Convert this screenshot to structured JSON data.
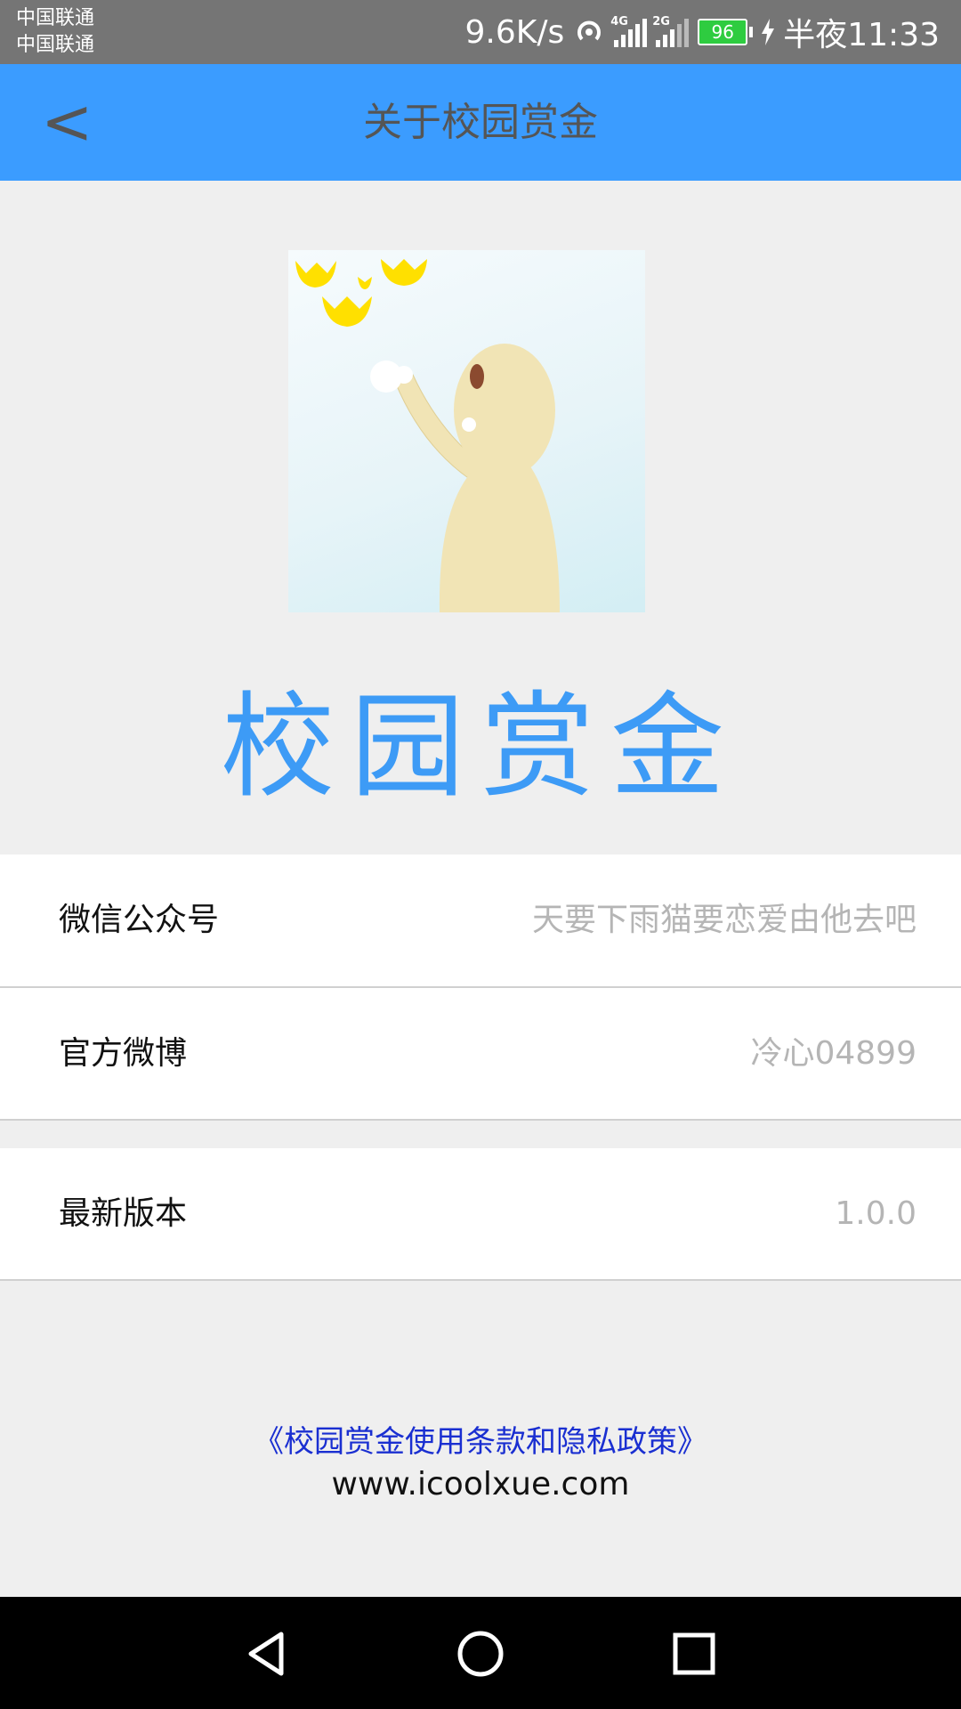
{
  "status_bar": {
    "carrier_1": "中国联通",
    "carrier_2": "中国联通",
    "net_speed": "9.6K/s",
    "signal_1_tag": "4G",
    "signal_2_tag": "2G",
    "battery": "96",
    "time": "半夜11:33"
  },
  "header": {
    "back_label": "<",
    "title": "关于校园赏金"
  },
  "logo": {
    "app_name": "校园赏金"
  },
  "info": {
    "wechat_label": "微信公众号",
    "wechat_value": "天要下雨猫要恋爱由他去吧",
    "weibo_label": "官方微博",
    "weibo_value": "冷心04899",
    "version_label": "最新版本",
    "version_value": "1.0.0"
  },
  "footer": {
    "policy_link": "《校园赏金使用条款和隐私政策》",
    "website": "www.icoolxue.com"
  },
  "colors": {
    "header_bg": "#3b9cff",
    "app_name": "#3d9bf6",
    "link": "#1a2fd1",
    "value_text": "#b5b5b5"
  }
}
